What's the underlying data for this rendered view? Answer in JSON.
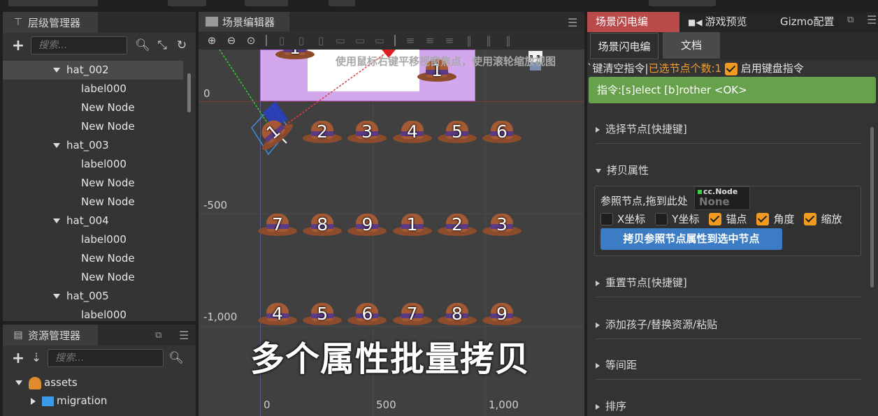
{
  "hierarchy": {
    "title": "层级管理器",
    "search_placeholder": "搜索...",
    "rows": [
      {
        "label": "hat_002",
        "level": 1,
        "expanded": true,
        "selected": true
      },
      {
        "label": "label000",
        "level": 2
      },
      {
        "label": "New Node",
        "level": 2
      },
      {
        "label": "New Node",
        "level": 2
      },
      {
        "label": "hat_003",
        "level": 1,
        "expanded": true
      },
      {
        "label": "label000",
        "level": 2
      },
      {
        "label": "New Node",
        "level": 2
      },
      {
        "label": "New Node",
        "level": 2
      },
      {
        "label": "hat_004",
        "level": 1,
        "expanded": true
      },
      {
        "label": "label000",
        "level": 2
      },
      {
        "label": "New Node",
        "level": 2
      },
      {
        "label": "New Node",
        "level": 2
      },
      {
        "label": "hat_005",
        "level": 1,
        "expanded": true
      },
      {
        "label": "label000",
        "level": 2
      }
    ]
  },
  "assets": {
    "title": "资源管理器",
    "search_placeholder": "搜索...",
    "items": [
      {
        "label": "assets",
        "expanded": true,
        "kind": "db"
      },
      {
        "label": "migration",
        "expanded": false,
        "kind": "folder"
      }
    ]
  },
  "scene": {
    "title": "场景编辑器",
    "hint": "使用鼠标右键平移视窗焦点，使用滚轮缩放视图",
    "caption": "多个属性批量拷贝",
    "y_labels": [
      "0",
      "-500",
      "-1,000"
    ],
    "x_labels": [
      "0",
      "500",
      "1,000"
    ],
    "row1": [
      "1",
      "2",
      "3",
      "4",
      "5",
      "6"
    ],
    "row2": [
      "7",
      "8",
      "9",
      "1",
      "2",
      "3"
    ],
    "row3": [
      "4",
      "5",
      "6",
      "7",
      "8",
      "9"
    ],
    "top_hats": [
      "1",
      "1"
    ]
  },
  "right": {
    "tabs": [
      "场景闪电编",
      "游戏预览",
      "Gizmo配置"
    ],
    "subtabs": [
      "场景闪电编",
      "文档"
    ],
    "info": {
      "prefix": "`键清空指令|",
      "selected_label": "已选节点个数:1",
      "keyboard_label": "启用键盘指令"
    },
    "command": "指令:[s]elect [b]rother <OK>",
    "sections": [
      "选择节点[快捷键]",
      "拷贝属性",
      "重置节点[快捷键]",
      "添加孩子/替换资源/粘贴",
      "等间距",
      "排序"
    ],
    "copy": {
      "ref_label": "参照节点,拖到此处",
      "node_tag": "cc.Node",
      "node_value": "None",
      "checks": [
        {
          "label": "X坐标",
          "checked": false
        },
        {
          "label": "Y坐标",
          "checked": false
        },
        {
          "label": "锚点",
          "checked": true
        },
        {
          "label": "角度",
          "checked": true
        },
        {
          "label": "缩放",
          "checked": true
        }
      ],
      "button": "拷贝参照节点属性到选中节点"
    }
  },
  "colors": {
    "active_tab": "#b94a4a",
    "command_bar": "#68a14c",
    "primary_button": "#3b7cc5",
    "checkbox_on": "#f09a20",
    "highlight_text": "#f0a030"
  }
}
